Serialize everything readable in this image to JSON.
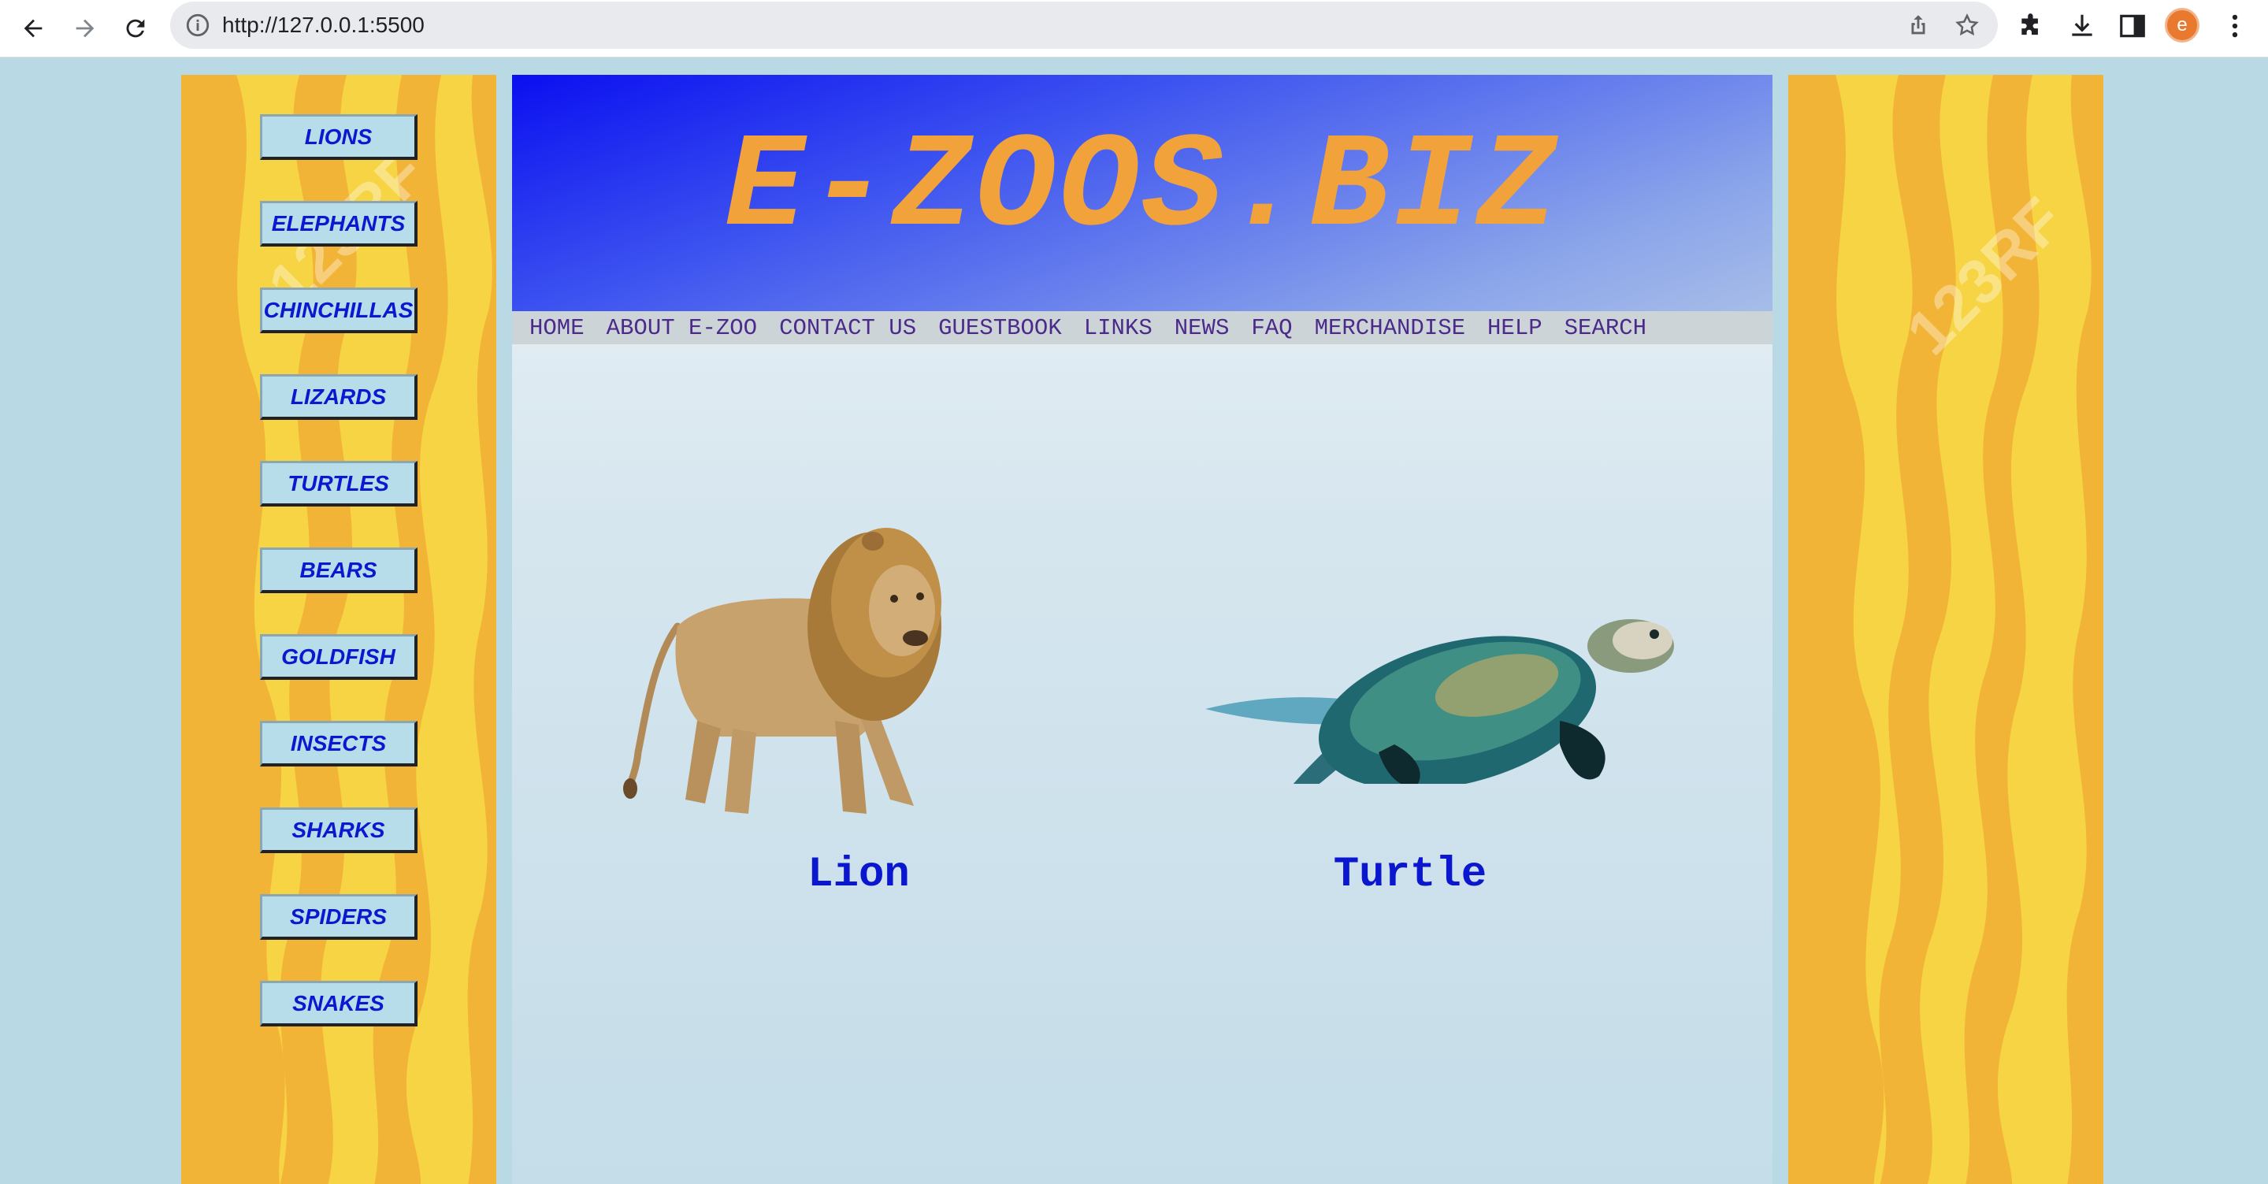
{
  "browser": {
    "url": "http://127.0.0.1:5500",
    "profile_initial": "e"
  },
  "side_nav": {
    "items": [
      "LIONS",
      "ELEPHANTS",
      "CHINCHILLAS",
      "LIZARDS",
      "TURTLES",
      "BEARS",
      "GOLDFISH",
      "INSECTS",
      "SHARKS",
      "SPIDERS",
      "SNAKES"
    ]
  },
  "header": {
    "title": "E-ZOOS.BIZ"
  },
  "top_nav": {
    "items": [
      "HOME",
      "ABOUT E-ZOO",
      "CONTACT US",
      "GUESTBOOK",
      "LINKS",
      "NEWS",
      "FAQ",
      "MERCHANDISE",
      "HELP",
      "SEARCH"
    ]
  },
  "animals": [
    {
      "caption": "Lion",
      "icon": "lion-image"
    },
    {
      "caption": "Turtle",
      "icon": "turtle-image"
    }
  ],
  "watermark": {
    "text": "123RF"
  },
  "colors": {
    "stripe_yellow": "#f7cb42",
    "stripe_orange": "#f2b437",
    "nav_text": "#0a18cf",
    "title": "#f2a23a",
    "banner_blue": "#0a0ff0"
  }
}
